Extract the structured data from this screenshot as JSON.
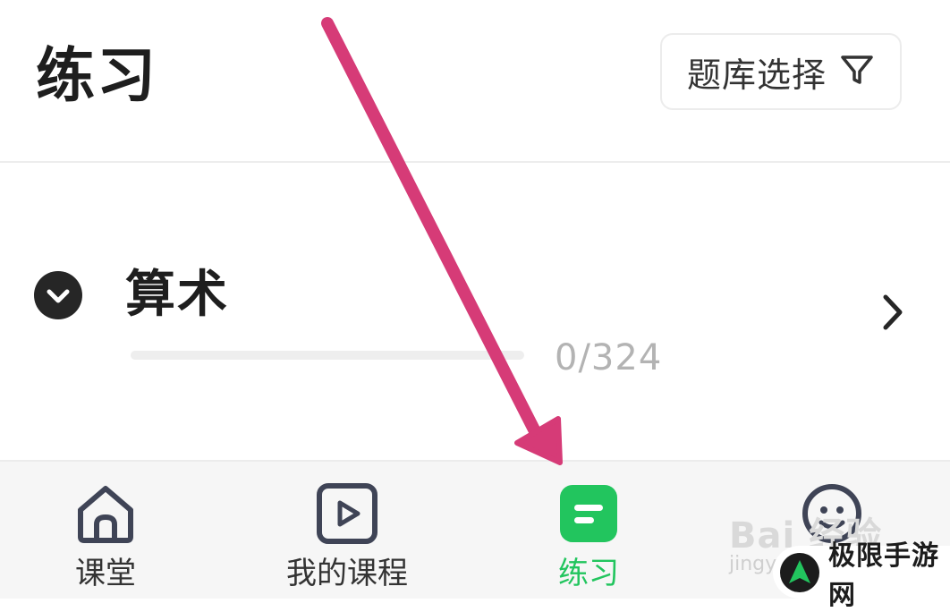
{
  "header": {
    "title": "练习",
    "filter_button": {
      "label": "题库选择",
      "icon": "filter-icon"
    }
  },
  "practice_item": {
    "title": "算术",
    "progress_text": "0/324",
    "progress_fraction": 0,
    "toggle_icon": "chevron-down-circle-icon",
    "chevron_icon": "chevron-right-icon"
  },
  "tabbar": {
    "tabs": [
      {
        "label": "课堂",
        "icon": "home-icon",
        "active": false
      },
      {
        "label": "我的课程",
        "icon": "play-icon",
        "active": false
      },
      {
        "label": "练习",
        "icon": "practice-icon",
        "active": true
      },
      {
        "label": "",
        "icon": "profile-icon",
        "active": false
      }
    ]
  },
  "annotation": {
    "type": "arrow",
    "color": "#d63b77",
    "points_to": "练习"
  },
  "watermark": {
    "baidu": "Bai 经验",
    "jingyan": "jingy",
    "site": "极限手游网"
  },
  "colors": {
    "accent": "#22c55e",
    "arrow": "#d63b77",
    "text": "#1e1e1e",
    "muted": "#b3b3b3"
  }
}
